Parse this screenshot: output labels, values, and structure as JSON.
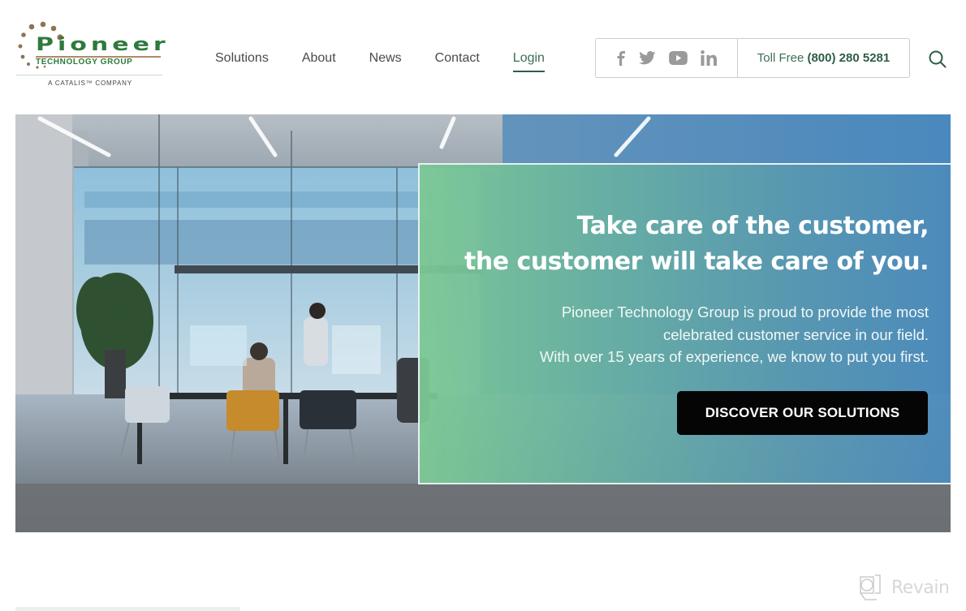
{
  "brand": {
    "name": "Pioneer",
    "subtitle": "TECHNOLOGY GROUP",
    "tagline": "A CATALIS™ COMPANY",
    "primary_color": "#2e7a3c",
    "dot_color": "#8c7455"
  },
  "nav": {
    "items": [
      {
        "label": "Solutions",
        "active": false
      },
      {
        "label": "About",
        "active": false
      },
      {
        "label": "News",
        "active": false
      },
      {
        "label": "Contact",
        "active": false
      },
      {
        "label": "Login",
        "active": true
      }
    ]
  },
  "social": {
    "icons": [
      "facebook-icon",
      "twitter-icon",
      "youtube-icon",
      "linkedin-icon"
    ]
  },
  "contact": {
    "toll_label": "Toll Free",
    "phone": "(800) 280 5281"
  },
  "search": {
    "icon": "search-icon"
  },
  "hero": {
    "title_line1": "Take care of the customer,",
    "title_line2": "the customer will take care of you.",
    "text_line1": "Pioneer Technology Group is proud to provide the most",
    "text_line2": "celebrated customer service in our field.",
    "text_line3": "With over 15 years of experience, we know to put you first.",
    "cta_label": "DISCOVER OUR SOLUTIONS",
    "image_alt": "Modern glass-walled office meeting room with people at a conference table"
  },
  "watermark": {
    "label": "Revain"
  }
}
